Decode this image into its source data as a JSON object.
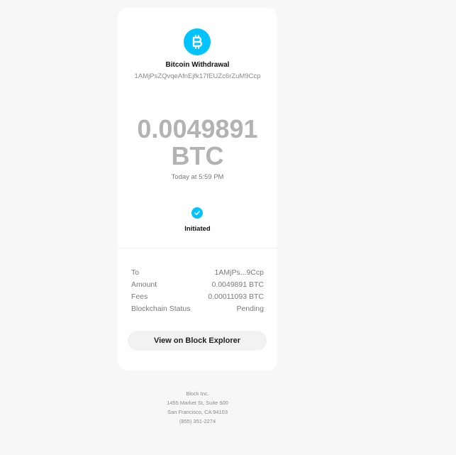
{
  "colors": {
    "accent": "#00c3ff",
    "background": "#f7f7f7",
    "card": "#ffffff",
    "amount_text": "#b3b3b3"
  },
  "header": {
    "icon": "bitcoin-icon",
    "title": "Bitcoin Withdrawal",
    "address": "1AMjPsZQvqeAfnEjfk17fEUZc6rZuM9Ccp"
  },
  "amount": {
    "value": "0.0049891",
    "unit": "BTC"
  },
  "timestamp": "Today at 5:59 PM",
  "status": {
    "icon": "check-icon",
    "label": "Initiated"
  },
  "details": [
    {
      "label": "To",
      "value": "1AMjPs...9Ccp"
    },
    {
      "label": "Amount",
      "value": "0.0049891 BTC"
    },
    {
      "label": "Fees",
      "value": "0.00011093 BTC"
    },
    {
      "label": "Blockchain Status",
      "value": "Pending"
    }
  ],
  "explorer_button": "View on Block Explorer",
  "footer": {
    "company": "Block Inc.",
    "street": "1455 Market St, Suite 600",
    "city": "San Francisco, CA 94103",
    "phone": "(855) 351-2274"
  }
}
